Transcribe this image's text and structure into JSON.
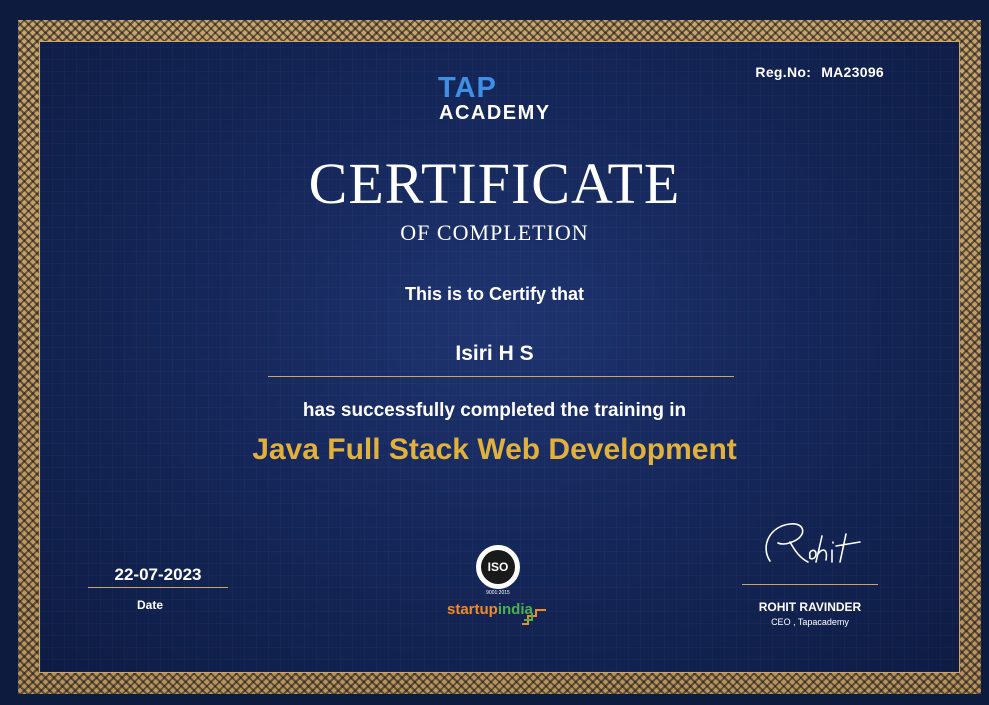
{
  "header": {
    "reg_label": "Reg.No:",
    "reg_number": "MA23096"
  },
  "logo": {
    "line1": "TAP",
    "line2": "ACADEMY"
  },
  "title": "CERTIFICATE",
  "subtitle": "OF COMPLETION",
  "certify_text": "This is to Certify that",
  "recipient_name": "Isiri H S",
  "completed_text": "has successfully completed the training in",
  "course_name": "Java Full Stack Web Development",
  "date": {
    "value": "22-07-2023",
    "label": "Date"
  },
  "badges": {
    "iso_text": "ISO",
    "iso_code": "9001:2015",
    "startup_part1": "startup",
    "startup_part2": "india"
  },
  "signatory": {
    "signature": "Rohit",
    "name": "ROHIT RAVINDER",
    "title": "CEO , Tapacademy"
  },
  "colors": {
    "background": "#15275a",
    "border_gold": "#c8a56a",
    "course_gold": "#e2b13c",
    "logo_blue": "#3f8fe6"
  }
}
